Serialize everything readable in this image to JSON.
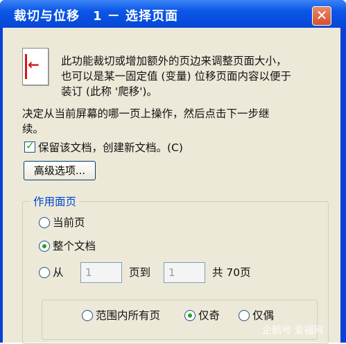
{
  "window": {
    "title": "裁切与位移　1 － 选择页面",
    "close_glyph": "✕"
  },
  "description": {
    "line1": "此功能裁切或增加额外的页边来调整页面大小，",
    "line2": "也可以是某一固定值 (变量) 位移页面内容以便于",
    "line3": "装订 (此称 '爬移')。"
  },
  "instruction": {
    "line1": "决定从当前屏幕的哪一页上操作，然后点击下一步继",
    "line2": "续。"
  },
  "keep_document": {
    "label": "保留该文档，创建新文档。(C)",
    "checked": true
  },
  "advanced_button": {
    "label": "高级选项..."
  },
  "scope_group": {
    "title": "作用面页",
    "current_page": "当前页",
    "whole_document": "整个文档",
    "from_label": "从",
    "from_value": "1",
    "to_label": "页到",
    "to_value": "1",
    "total_label": "共 70页",
    "selected": "whole_document"
  },
  "range_group": {
    "all_pages": "范围内所有页",
    "odd_only": "仅奇",
    "even_only": "仅偶",
    "selected": "odd_only"
  },
  "watermark": "企鹅号 爱福网",
  "colors": {
    "title_bar": "#0b56e6",
    "dialog_bg": "#ece9d8",
    "accent_green": "#21a121",
    "group_title": "#0046d5",
    "close_red": "#d4502f"
  }
}
